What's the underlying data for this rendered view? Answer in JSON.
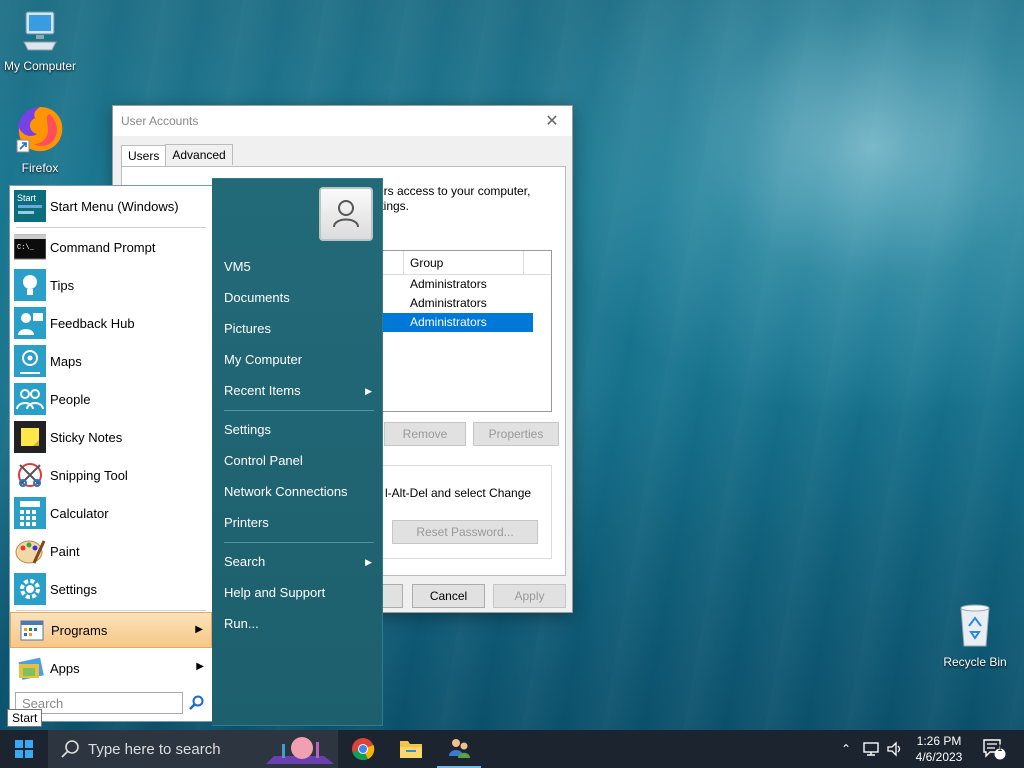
{
  "desktop": {
    "icons": [
      {
        "name": "My Computer"
      },
      {
        "name": "Firefox"
      },
      {
        "name": "Recycle Bin"
      }
    ]
  },
  "user_accounts": {
    "title": "User Accounts",
    "tabs": [
      "Users",
      "Advanced"
    ],
    "description_line1": "ers access to your computer,",
    "description_line2": "ttings.",
    "list_header": "Group",
    "groups": [
      "Administrators",
      "Administrators",
      "Administrators"
    ],
    "selected_index": 2,
    "remove_button": "Remove",
    "properties_button": "Properties",
    "password_text": "l-Alt-Del and select Change",
    "reset_password_button": "Reset Password...",
    "cancel_button": "Cancel",
    "apply_button": "Apply"
  },
  "start_menu": {
    "left_items": [
      {
        "label": "Start Menu (Windows)",
        "icon": "start-menu-icon"
      },
      {
        "label": "Command Prompt",
        "icon": "command-prompt-icon"
      },
      {
        "label": "Tips",
        "icon": "tips-icon"
      },
      {
        "label": "Feedback Hub",
        "icon": "feedback-hub-icon"
      },
      {
        "label": "Maps",
        "icon": "maps-icon"
      },
      {
        "label": "People",
        "icon": "people-icon"
      },
      {
        "label": "Sticky Notes",
        "icon": "sticky-notes-icon"
      },
      {
        "label": "Snipping Tool",
        "icon": "snipping-tool-icon"
      },
      {
        "label": "Calculator",
        "icon": "calculator-icon"
      },
      {
        "label": "Paint",
        "icon": "paint-icon"
      },
      {
        "label": "Settings",
        "icon": "settings-icon"
      }
    ],
    "programs_label": "Programs",
    "apps_label": "Apps",
    "search_placeholder": "Search",
    "right_items": [
      "VM5",
      "Documents",
      "Pictures",
      "My Computer",
      "Recent Items",
      "Settings",
      "Control Panel",
      "Network Connections",
      "Printers",
      "Search",
      "Help and Support",
      "Run..."
    ],
    "tooltip": "Start"
  },
  "taskbar": {
    "search_placeholder": "Type here to search",
    "time": "1:26 PM",
    "date": "4/6/2023",
    "notification_count": "1"
  },
  "colors": {
    "accent": "#0078d7",
    "start_right_panel": "#236a78",
    "taskbar": "#1c2430",
    "programs_highlight": "#f7c787"
  }
}
